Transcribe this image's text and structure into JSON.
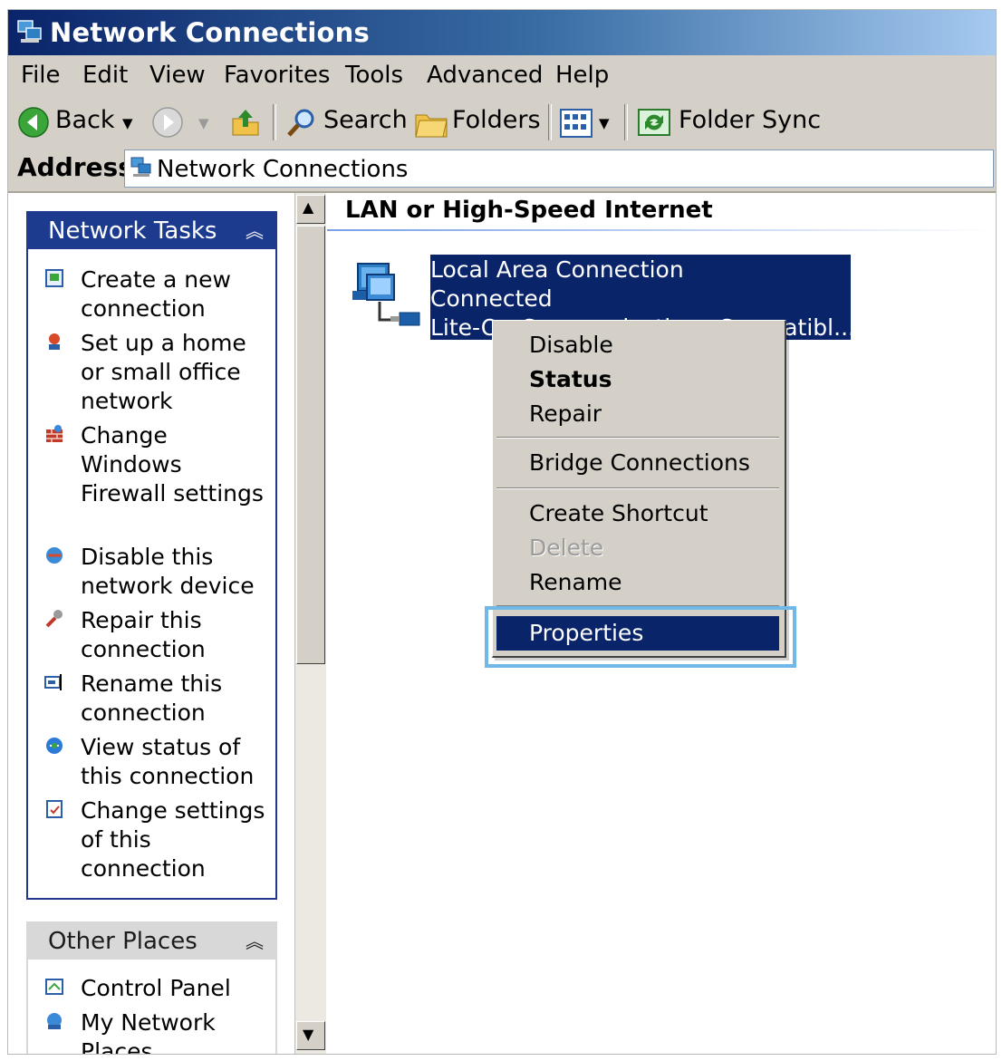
{
  "window": {
    "title": "Network Connections",
    "title_icon": "network-connections-icon"
  },
  "menubar": {
    "items": [
      "File",
      "Edit",
      "View",
      "Favorites",
      "Tools",
      "Advanced",
      "Help"
    ]
  },
  "toolbar": {
    "back_label": "Back",
    "search_label": "Search",
    "folders_label": "Folders",
    "folder_sync_label": "Folder Sync"
  },
  "address": {
    "label": "Address",
    "value": "Network Connections"
  },
  "network_tasks": {
    "title": "Network Tasks",
    "items": [
      {
        "label": "Create a new connection",
        "icon": "new-connection-icon"
      },
      {
        "label": "Set up a home or small office network",
        "icon": "home-network-icon"
      },
      {
        "label": "Change Windows Firewall settings",
        "icon": "firewall-icon"
      },
      {
        "label": "Disable this network device",
        "icon": "disable-device-icon"
      },
      {
        "label": "Repair this connection",
        "icon": "repair-icon"
      },
      {
        "label": "Rename this connection",
        "icon": "rename-icon"
      },
      {
        "label": "View status of this connection",
        "icon": "status-icon"
      },
      {
        "label": "Change settings of this connection",
        "icon": "settings-icon"
      }
    ]
  },
  "other_places": {
    "title": "Other Places",
    "items": [
      {
        "label": "Control Panel",
        "icon": "control-panel-icon"
      },
      {
        "label": "My Network Places",
        "icon": "my-network-places-icon"
      }
    ]
  },
  "main": {
    "group_title": "LAN or High-Speed Internet",
    "connection": {
      "name": "Local Area Connection",
      "status": "Connected",
      "device": "Lite-On Communications Compatibl..."
    }
  },
  "context_menu": {
    "items": [
      {
        "label": "Disable"
      },
      {
        "label": "Status"
      },
      {
        "label": "Repair"
      },
      {
        "label": "Bridge Connections"
      },
      {
        "label": "Create Shortcut"
      },
      {
        "label": "Delete"
      },
      {
        "label": "Rename"
      },
      {
        "label": "Properties"
      }
    ]
  },
  "colors": {
    "selection": "#0a246a",
    "task_header": "#1c3b8e",
    "focus_outline": "#6fb8e8",
    "chrome": "#d4d0c8"
  }
}
